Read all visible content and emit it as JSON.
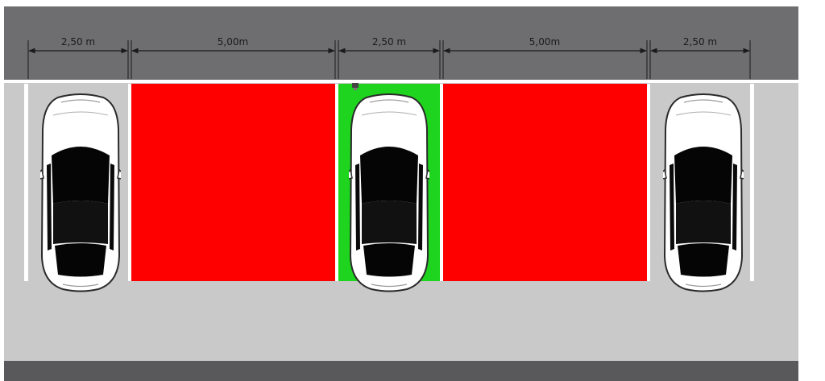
{
  "colors": {
    "background": "#ffffff",
    "road_top": "#6e6e70",
    "sidewalk": "#c9c9c9",
    "road_bottom": "#59595b",
    "line_white": "#ffffff",
    "blocked_zone": "#ff0000",
    "charging_bay": "#1fd41f",
    "dimension_line": "#1a1a1a",
    "car_body": "#ffffff",
    "car_glass": "#050505"
  },
  "dimensions": [
    {
      "label": "2,50 m"
    },
    {
      "label": "5,00m"
    },
    {
      "label": "2,50 m"
    },
    {
      "label": "5,00m"
    },
    {
      "label": "2,50 m"
    }
  ],
  "zones": [
    {
      "kind": "blocked"
    },
    {
      "kind": "charging"
    },
    {
      "kind": "blocked"
    }
  ],
  "cars": [
    {
      "icon": "car-top-view-icon"
    },
    {
      "icon": "car-top-view-icon"
    },
    {
      "icon": "car-top-view-icon"
    }
  ],
  "charger": {
    "icon": "charging-station-icon"
  }
}
